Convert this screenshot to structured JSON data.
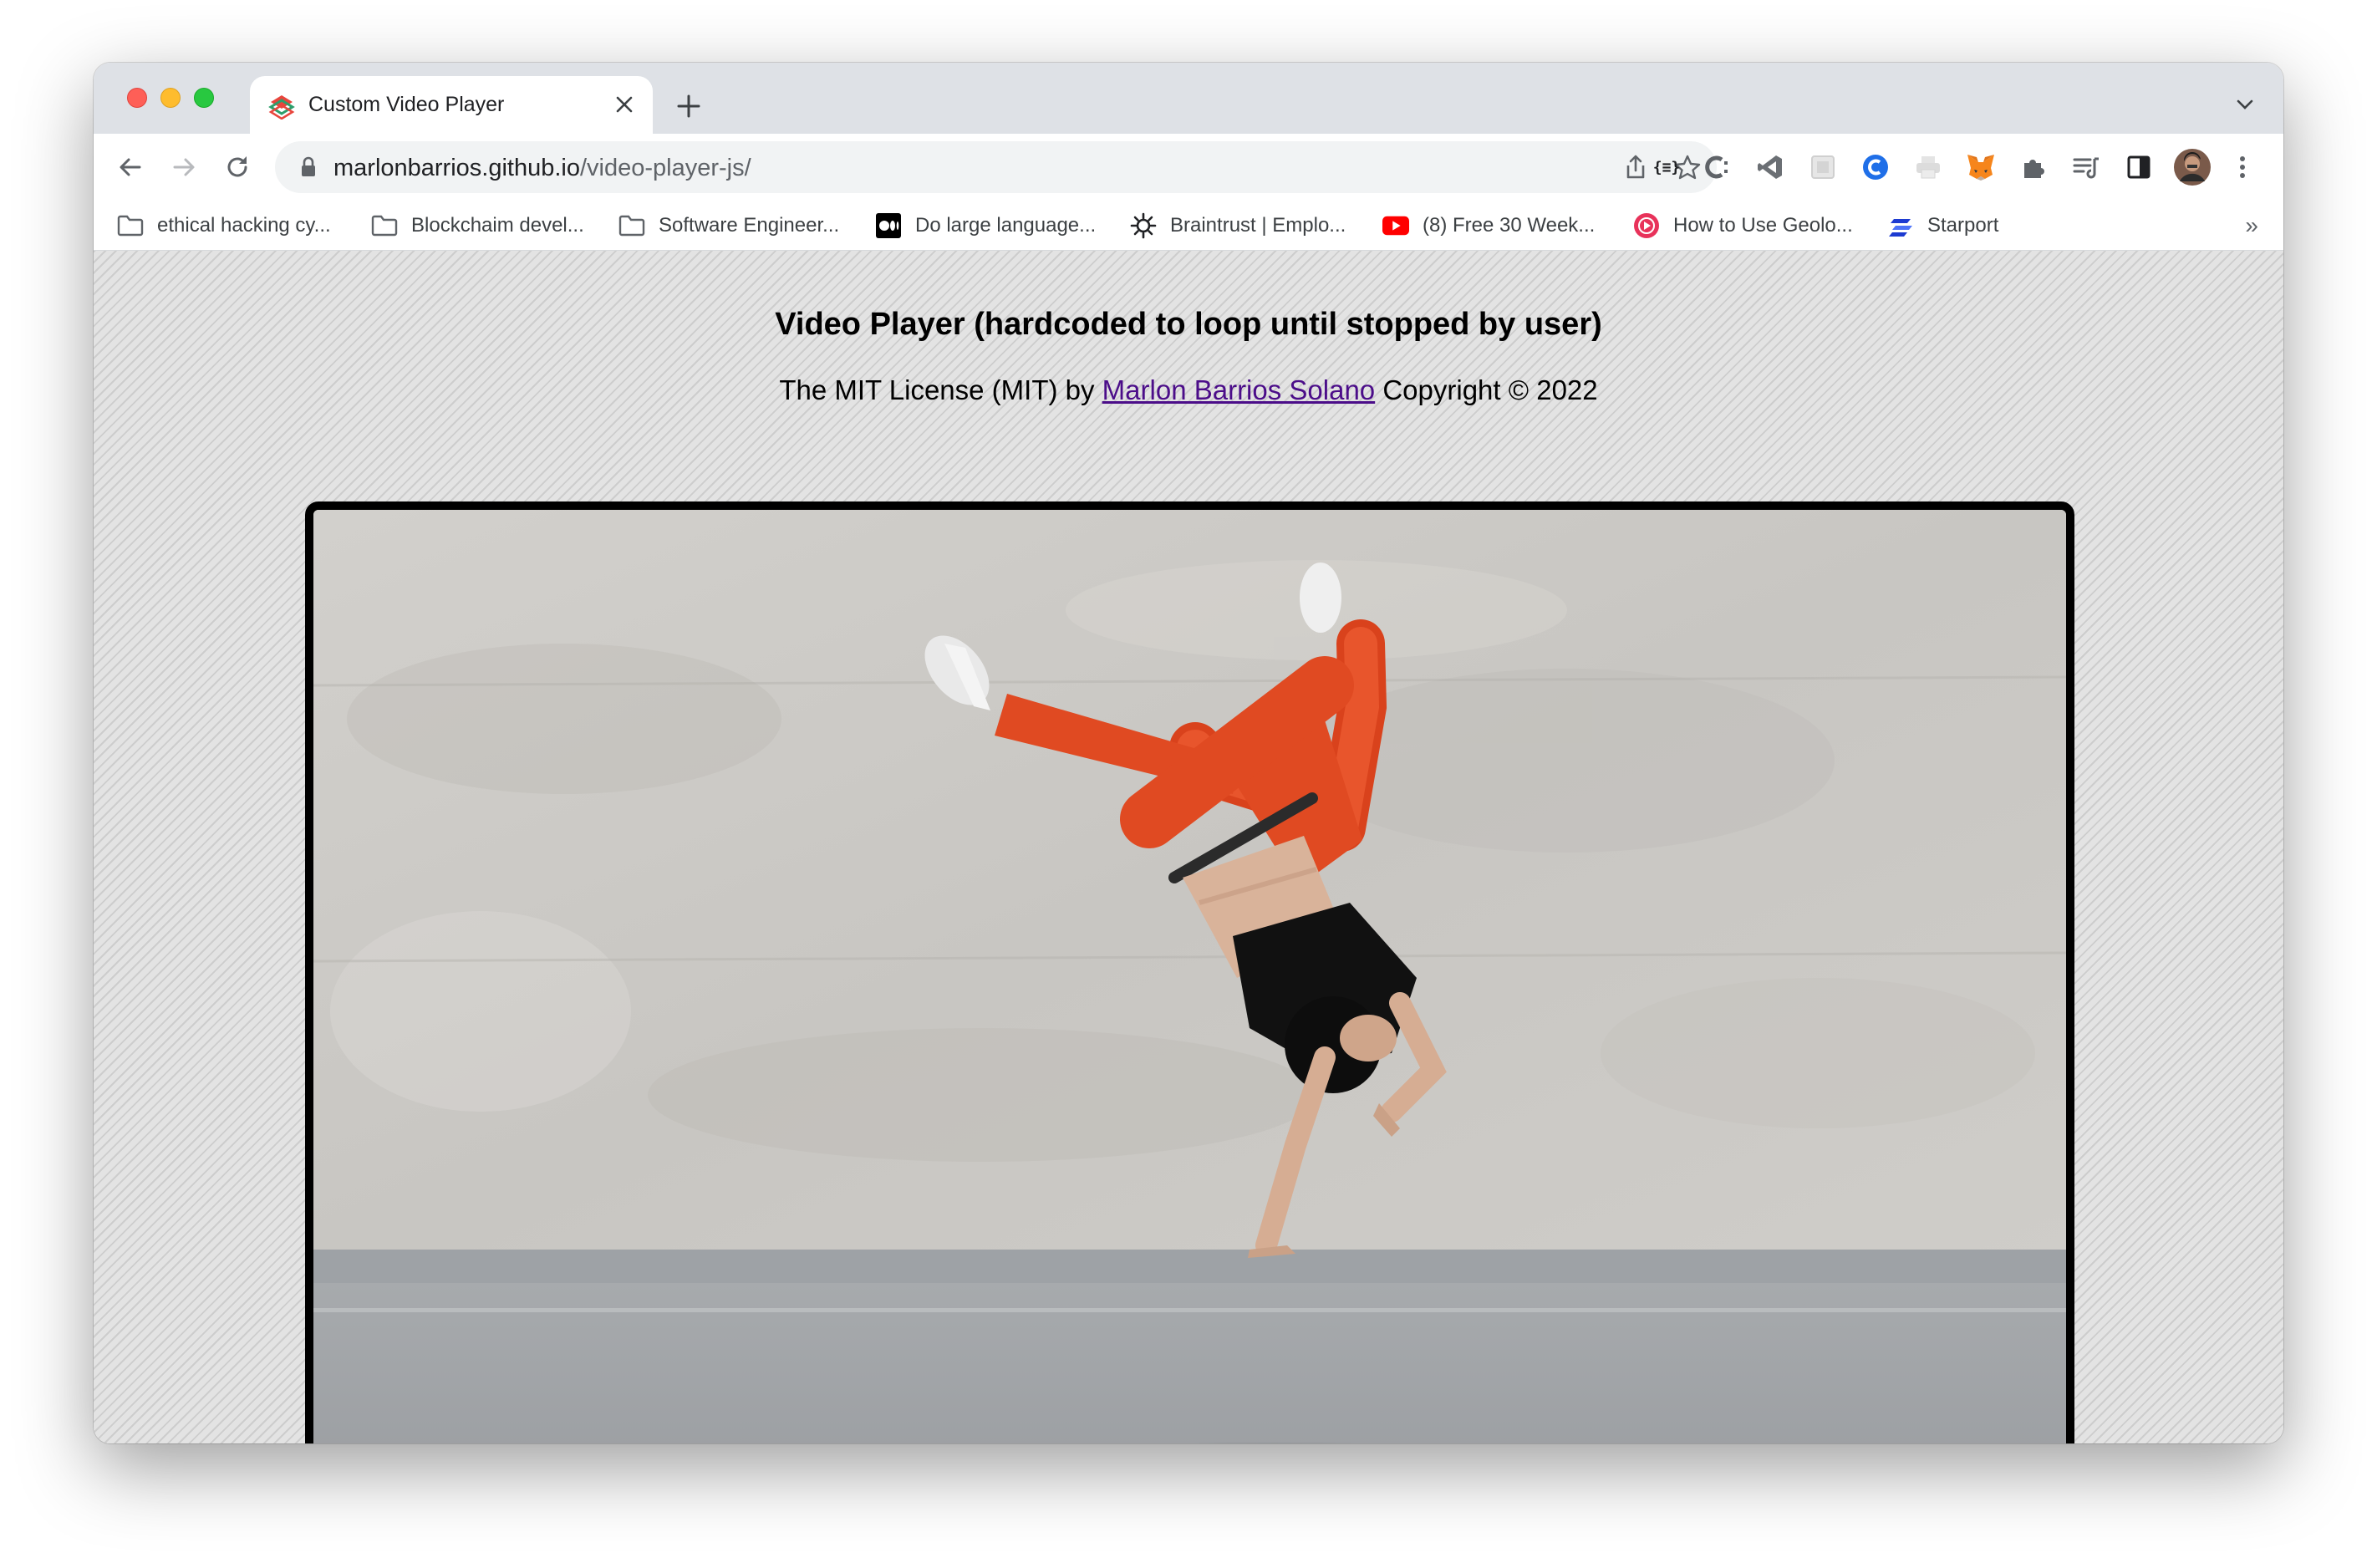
{
  "browser": {
    "tab": {
      "title": "Custom Video Player"
    },
    "address_bar": {
      "host": "marlonbarrios.github.io",
      "path": "/video-player-js/"
    },
    "bookmarks": [
      {
        "label": "ethical hacking cy...",
        "icon": "folder-icon"
      },
      {
        "label": "Blockchaim devel...",
        "icon": "folder-icon"
      },
      {
        "label": "Software Engineer...",
        "icon": "folder-icon"
      },
      {
        "label": "Do large language...",
        "icon": "medium-icon"
      },
      {
        "label": "Braintrust | Emplo...",
        "icon": "braintrust-icon"
      },
      {
        "label": "(8) Free 30 Week...",
        "icon": "youtube-icon"
      },
      {
        "label": "How to Use Geolo...",
        "icon": "circle-play-icon"
      },
      {
        "label": "Starport",
        "icon": "starport-icon"
      }
    ],
    "bookmarks_overflow": "»"
  },
  "page": {
    "title": "Video Player (hardcoded to loop until stopped by user)",
    "license_prefix": "The MIT License (MIT) by ",
    "license_author": "Marlon Barrios Solano",
    "license_suffix": " Copyright © 2022"
  },
  "colors": {
    "tab_strip": "#dee1e6",
    "link": "#4b0d89",
    "pants": "#e0461f",
    "page_pattern": "#dcdcdc"
  }
}
